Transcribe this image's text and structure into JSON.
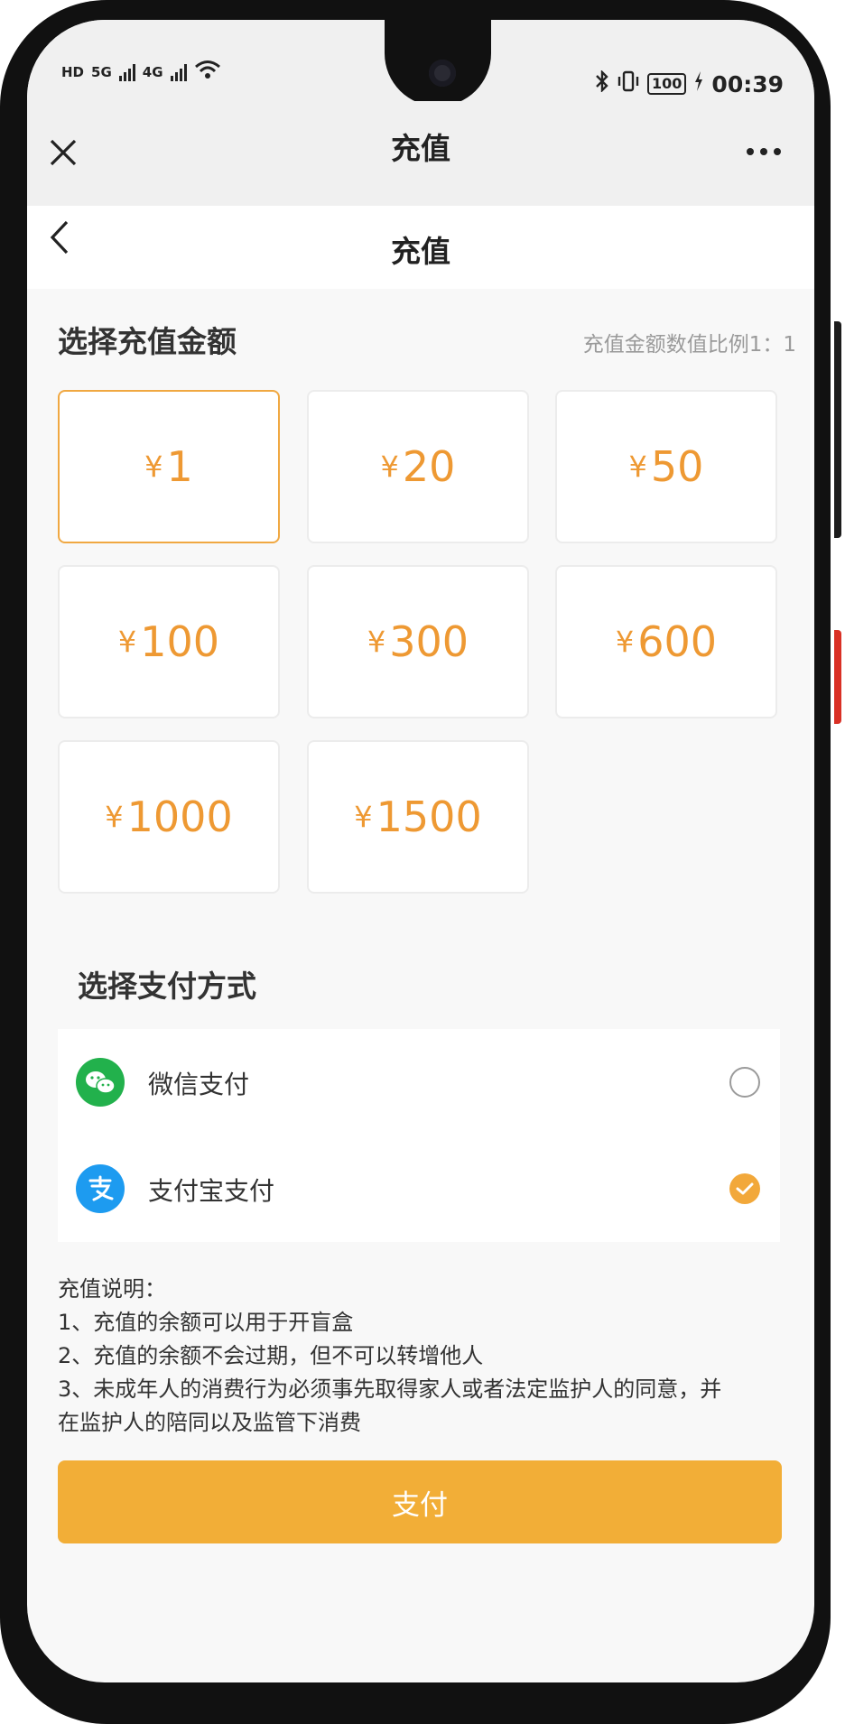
{
  "status_bar": {
    "time": "00:39",
    "battery": "100",
    "signal_1": "5G",
    "signal_2": "4G",
    "hd": "HD"
  },
  "title_bar": {
    "title": "充值"
  },
  "nav_bar": {
    "title": "充值"
  },
  "amount_section": {
    "title": "选择充值金额",
    "ratio_note": "充值金额数值比例1：1",
    "currency": "¥",
    "selected": "1",
    "options": [
      "1",
      "20",
      "50",
      "100",
      "300",
      "600",
      "1000",
      "1500"
    ]
  },
  "payment_section": {
    "title": "选择支付方式",
    "methods": [
      {
        "label": "微信支付",
        "icon": "wechat-pay-icon",
        "selected": false,
        "color": "#22b14c"
      },
      {
        "label": "支付宝支付",
        "icon": "alipay-icon",
        "selected": true,
        "color": "#1d9bf0"
      }
    ]
  },
  "notes": {
    "heading": "充值说明：",
    "lines": [
      "1、充值的余额可以用于开盲盒",
      "2、充值的余额不会过期，但不可以转增他人",
      "3、未成年人的消费行为必须事先取得家人或者法定监护人的同意，并",
      "在监护人的陪同以及监管下消费"
    ]
  },
  "pay_button": {
    "label": "支付"
  },
  "colors": {
    "accent": "#f2ae37",
    "amount_text": "#ee9933"
  }
}
